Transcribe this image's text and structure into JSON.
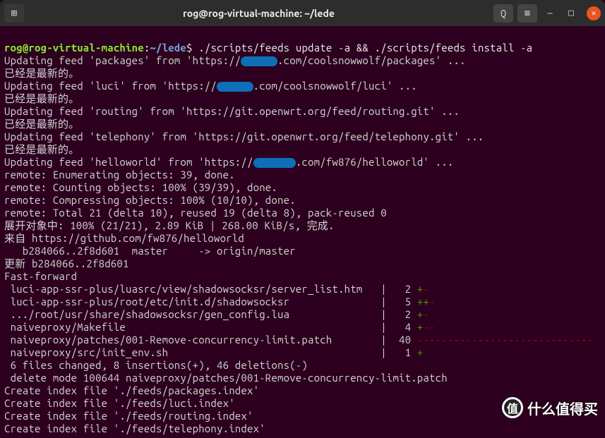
{
  "titlebar": {
    "title": "rog@rog-virtual-machine: ~/lede",
    "new_tab_icon": "⊞",
    "search_icon": "Q",
    "menu_icon": "≡",
    "min_icon": "—",
    "max_icon": "□",
    "close_icon": "✕"
  },
  "prompt": {
    "user_host": "rog@rog-virtual-machine",
    "sep1": ":",
    "path": "~/lede",
    "sep2": "$",
    "command": " ./scripts/feeds update -a && ./scripts/feeds install -a"
  },
  "lines": {
    "l01a": "Updating feed 'packages' from 'https://",
    "l01r": "XXXXXX",
    "l01b": ".com/coolsnowwolf/packages' ...",
    "l02": "已经是最新的。",
    "l03a": "Updating feed 'luci' from 'https://",
    "l03r": "XXXXXX",
    "l03b": ".com/coolsnowwolf/luci' ...",
    "l04": "已经是最新的。",
    "l05": "Updating feed 'routing' from 'https://git.openwrt.org/feed/routing.git' ...",
    "l06": "已经是最新的。",
    "l07": "Updating feed 'telephony' from 'https://git.openwrt.org/feed/telephony.git' ...",
    "l08": "已经是最新的。",
    "l09a": "Updating feed 'helloworld' from 'https://",
    "l09r": "XXXXXXX",
    "l09b": ".com/fw876/helloworld' ...",
    "l10": "remote: Enumerating objects: 39, done.",
    "l11": "remote: Counting objects: 100% (39/39), done.",
    "l12": "remote: Compressing objects: 100% (10/10), done.",
    "l13": "remote: Total 21 (delta 10), reused 19 (delta 8), pack-reused 0",
    "l14": "展开对象中: 100% (21/21), 2.89 KiB | 268.00 KiB/s, 完成.",
    "l15": "来自 https://github.com/fw876/helloworld",
    "l16": "   b284066..2f8d601  master     -> origin/master",
    "l17": "更新 b284066..2f8d601",
    "l18": "Fast-forward",
    "l19a": " luci-app-ssr-plus/luasrc/view/shadowsocksr/server_list.htm   |   2 ",
    "l19p": "+",
    "l19m": "-",
    "l20a": " luci-app-ssr-plus/root/etc/init.d/shadowsocksr               |   5 ",
    "l20p": "++",
    "l20m": "-",
    "l21a": " .../root/usr/share/shadowsocksr/gen_config.lua               |   2 ",
    "l21p": "+",
    "l21m": "-",
    "l22a": " naiveproxy/Makefile                                          |   4 ",
    "l22p": "+",
    "l22m": "--",
    "l23a": " naiveproxy/patches/001-Remove-concurrency-limit.patch        |  40 ",
    "l23m": "-----------------------------",
    "l24a": " naiveproxy/src/init_env.sh                                   |   1 ",
    "l24p": "+",
    "l25": " 6 files changed, 8 insertions(+), 46 deletions(-)",
    "l26": " delete mode 100644 naiveproxy/patches/001-Remove-concurrency-limit.patch",
    "l27": "Create index file './feeds/packages.index'",
    "l28": "Create index file './feeds/luci.index'",
    "l29": "Create index file './feeds/routing.index'",
    "l30": "Create index file './feeds/telephony.index'"
  },
  "watermark": {
    "badge": "值",
    "text": "什么值得买"
  }
}
